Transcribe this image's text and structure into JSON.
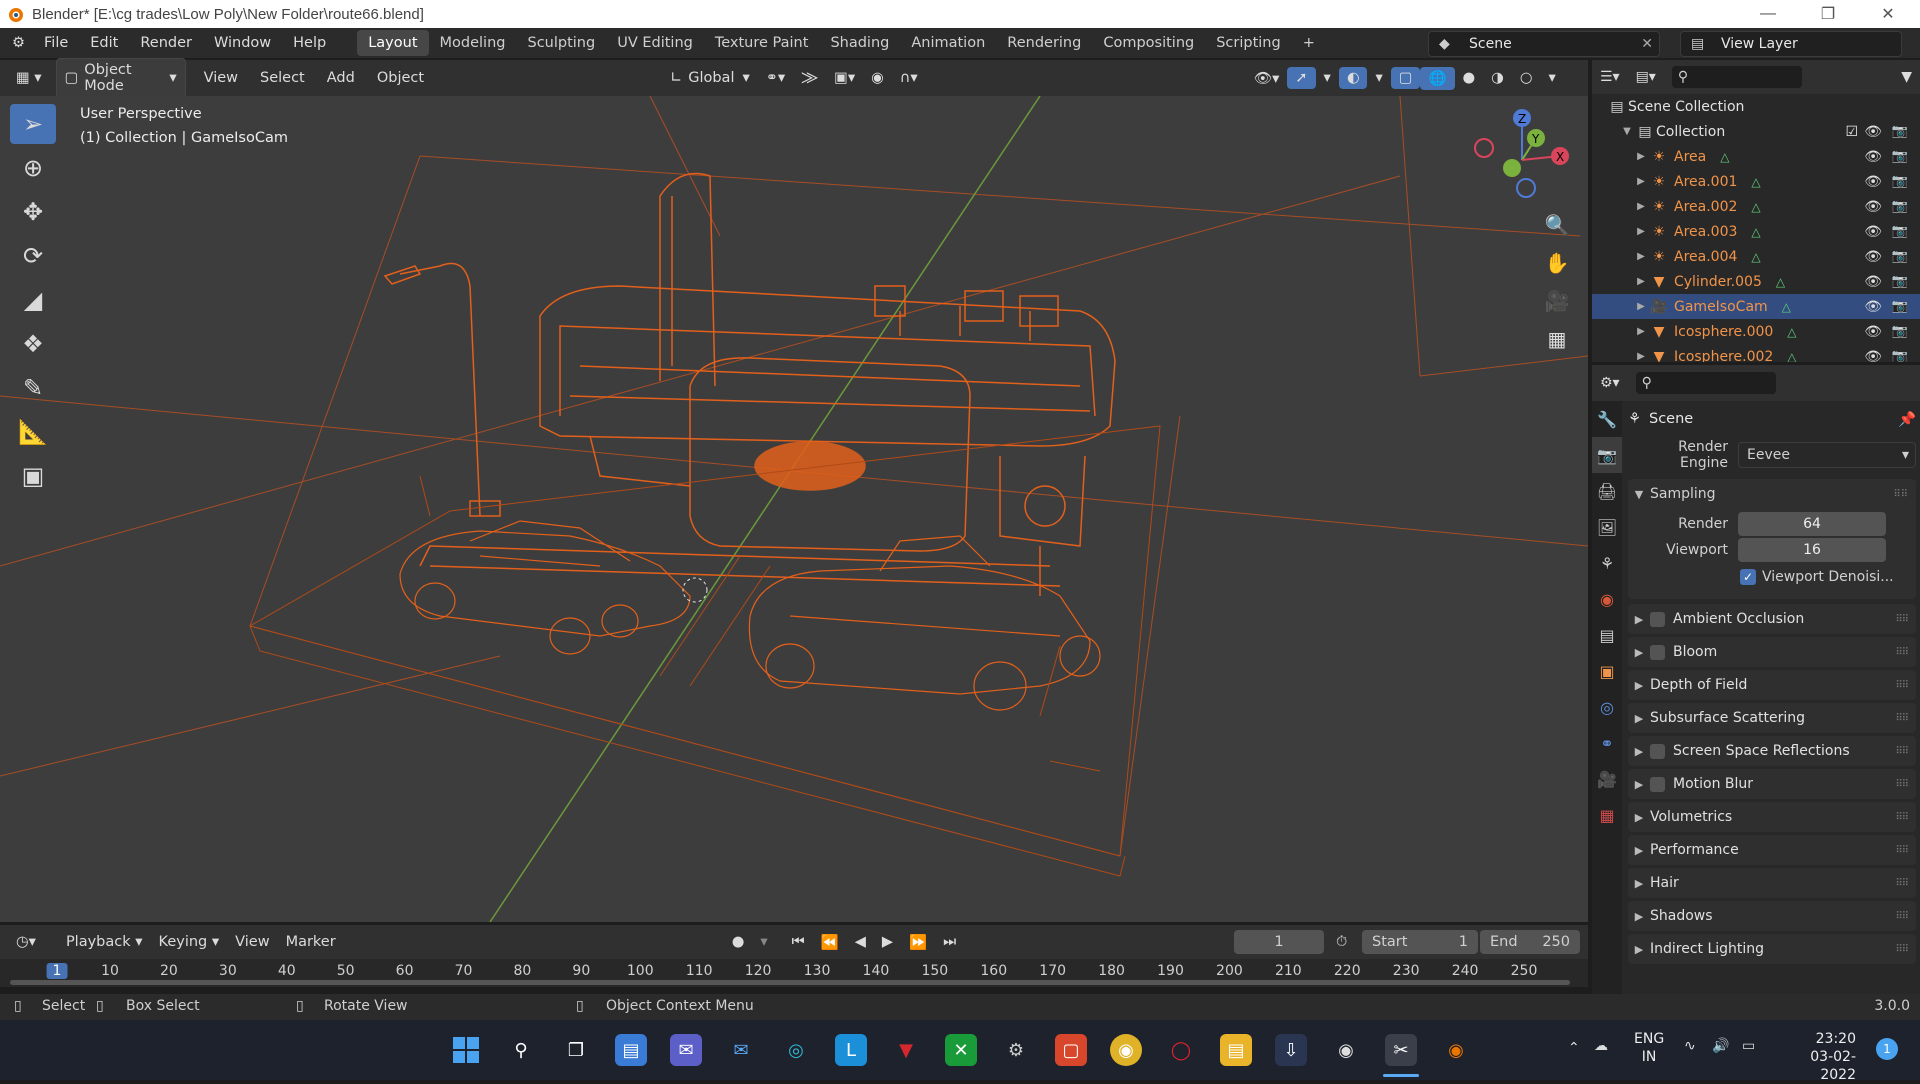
{
  "window": {
    "title": "Blender* [E:\\cg trades\\Low Poly\\New Folder\\route66.blend]"
  },
  "menu": {
    "items": [
      "File",
      "Edit",
      "Render",
      "Window",
      "Help"
    ]
  },
  "workspaces": [
    "Layout",
    "Modeling",
    "Sculpting",
    "UV Editing",
    "Texture Paint",
    "Shading",
    "Animation",
    "Rendering",
    "Compositing",
    "Scripting"
  ],
  "scene_name": "Scene",
  "view_layer": "View Layer",
  "viewport": {
    "mode": "Object Mode",
    "menus": [
      "View",
      "Select",
      "Add",
      "Object"
    ],
    "orientation": "Global",
    "perspective_label": "User Perspective",
    "collection_label": "(1) Collection | GameIsoCam",
    "gizmo": {
      "z": "Z",
      "y": "Y",
      "x": "X"
    }
  },
  "outliner": {
    "scene_collection": "Scene Collection",
    "collection": "Collection",
    "items": [
      {
        "name": "Area",
        "icon": "light-icon"
      },
      {
        "name": "Area.001",
        "icon": "light-icon"
      },
      {
        "name": "Area.002",
        "icon": "light-icon"
      },
      {
        "name": "Area.003",
        "icon": "light-icon"
      },
      {
        "name": "Area.004",
        "icon": "light-icon"
      },
      {
        "name": "Cylinder.005",
        "icon": "mesh-icon"
      },
      {
        "name": "GameIsoCam",
        "icon": "camera-icon",
        "selected": true
      },
      {
        "name": "Icosphere.000",
        "icon": "mesh-icon"
      },
      {
        "name": "Icosphere.002",
        "icon": "mesh-icon"
      }
    ]
  },
  "properties": {
    "context": "Scene",
    "render_engine_label": "Render Engine",
    "render_engine": "Eevee",
    "sampling": {
      "label": "Sampling",
      "render_label": "Render",
      "render": "64",
      "viewport_label": "Viewport",
      "viewport": "16",
      "denoise_label": "Viewport Denoisi..."
    },
    "panels": [
      {
        "label": "Ambient Occlusion",
        "checkbox": true
      },
      {
        "label": "Bloom",
        "checkbox": true
      },
      {
        "label": "Depth of Field",
        "checkbox": false
      },
      {
        "label": "Subsurface Scattering",
        "checkbox": false
      },
      {
        "label": "Screen Space Reflections",
        "checkbox": true
      },
      {
        "label": "Motion Blur",
        "checkbox": true
      },
      {
        "label": "Volumetrics",
        "checkbox": false
      },
      {
        "label": "Performance",
        "checkbox": false
      },
      {
        "label": "Hair",
        "checkbox": false
      },
      {
        "label": "Shadows",
        "checkbox": false
      },
      {
        "label": "Indirect Lighting",
        "checkbox": false
      }
    ]
  },
  "timeline": {
    "menus": [
      "Playback",
      "Keying",
      "View",
      "Marker"
    ],
    "current_frame": "1",
    "start_label": "Start",
    "start": "1",
    "end_label": "End",
    "end": "250",
    "ticks": [
      "1",
      "10",
      "20",
      "30",
      "40",
      "50",
      "60",
      "70",
      "80",
      "90",
      "100",
      "110",
      "120",
      "130",
      "140",
      "150",
      "160",
      "170",
      "180",
      "190",
      "200",
      "210",
      "220",
      "230",
      "240",
      "250"
    ]
  },
  "status": {
    "select": "Select",
    "box_select": "Box Select",
    "rotate_view": "Rotate View",
    "context_menu": "Object Context Menu",
    "version": "3.0.0"
  },
  "taskbar": {
    "lang": "ENG",
    "region": "IN",
    "time": "23:20",
    "date": "03-02-2022",
    "notifications": "1"
  },
  "colors": {
    "accent": "#4772b3",
    "selection": "#e05a10",
    "object_name": "#f0944a"
  }
}
